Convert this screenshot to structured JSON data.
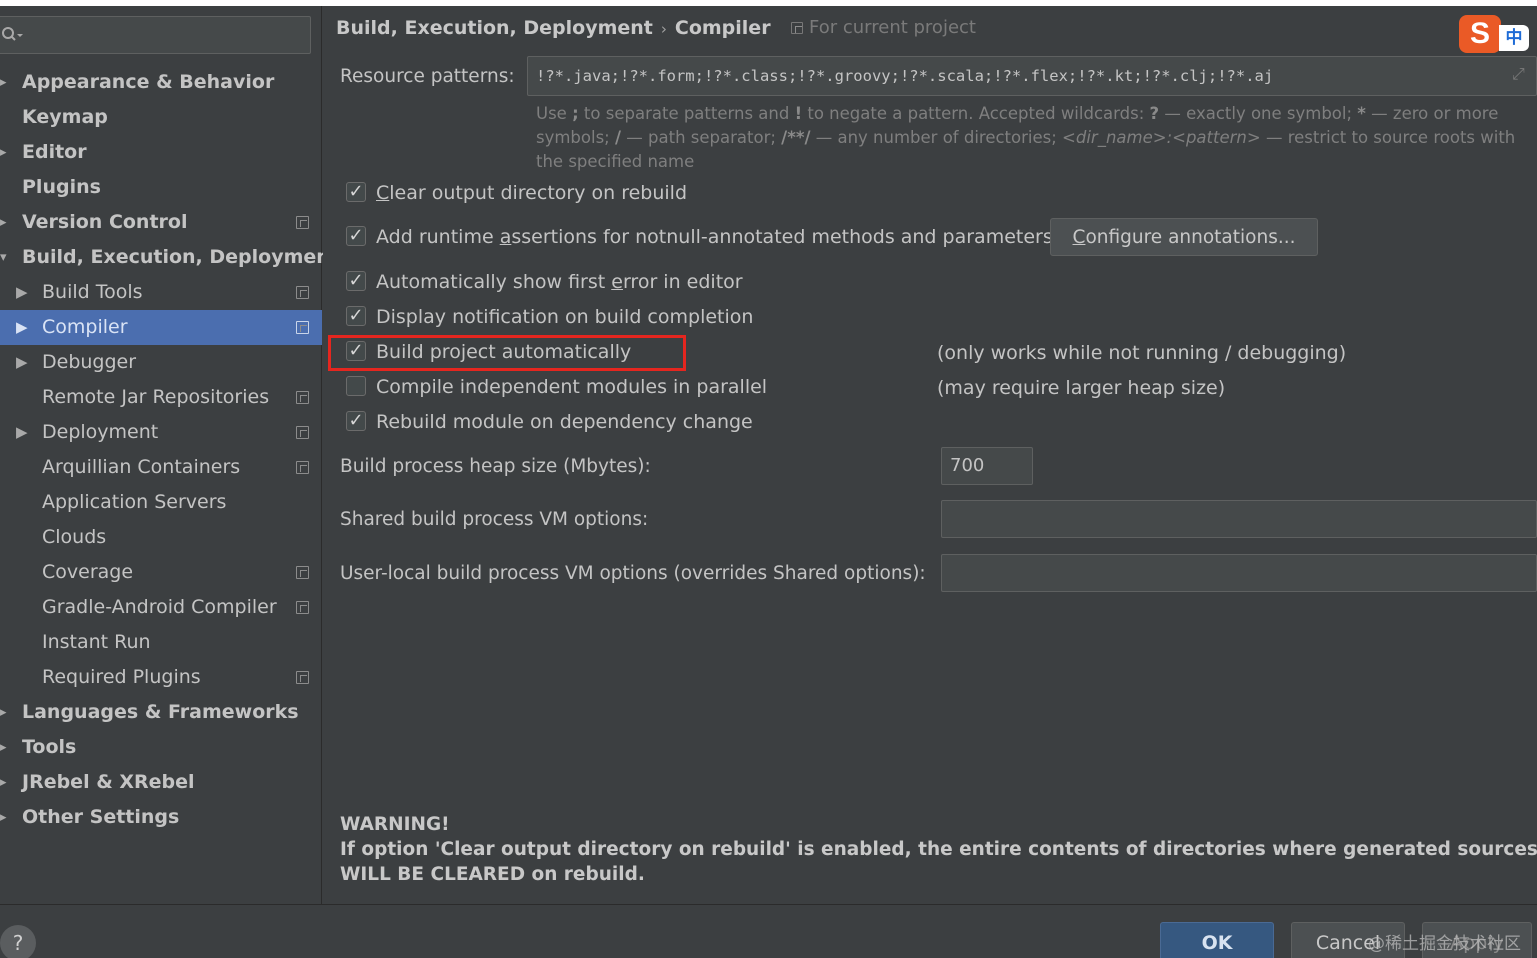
{
  "sidebar": {
    "search_placeholder": "",
    "items": [
      {
        "label": "Appearance & Behavior",
        "arrow": "▸"
      },
      {
        "label": "Keymap",
        "arrow": ""
      },
      {
        "label": "Editor",
        "arrow": "▸"
      },
      {
        "label": "Plugins",
        "arrow": ""
      },
      {
        "label": "Version Control",
        "arrow": "▸"
      },
      {
        "label": "Build, Execution, Deployment",
        "arrow": "▾"
      },
      {
        "label": "Build Tools",
        "arrow": "▶"
      },
      {
        "label": "Compiler",
        "arrow": "▶"
      },
      {
        "label": "Debugger",
        "arrow": "▶"
      },
      {
        "label": "Remote Jar Repositories",
        "arrow": ""
      },
      {
        "label": "Deployment",
        "arrow": "▶"
      },
      {
        "label": "Arquillian Containers",
        "arrow": ""
      },
      {
        "label": "Application Servers",
        "arrow": ""
      },
      {
        "label": "Clouds",
        "arrow": ""
      },
      {
        "label": "Coverage",
        "arrow": ""
      },
      {
        "label": "Gradle-Android Compiler",
        "arrow": ""
      },
      {
        "label": "Instant Run",
        "arrow": ""
      },
      {
        "label": "Required Plugins",
        "arrow": ""
      },
      {
        "label": "Languages & Frameworks",
        "arrow": "▸"
      },
      {
        "label": "Tools",
        "arrow": "▸"
      },
      {
        "label": "JRebel & XRebel",
        "arrow": "▸"
      },
      {
        "label": "Other Settings",
        "arrow": "▸"
      }
    ]
  },
  "header": {
    "crumb1": "Build, Execution, Deployment",
    "separator": "›",
    "crumb2": "Compiler",
    "for_project": "For current project",
    "ime_logo": "S",
    "ime_lang": "中"
  },
  "form": {
    "resource_label": "Resource patterns:",
    "resource_value": "!?*.java;!?*.form;!?*.class;!?*.groovy;!?*.scala;!?*.flex;!?*.kt;!?*.clj;!?*.aj",
    "hint": {
      "p1": "Use ",
      "semicolon": ";",
      "p2": " to separate patterns and ",
      "bang": "!",
      "p3": " to negate a pattern. Accepted wildcards: ",
      "q": "?",
      "p4": " — exactly one symbol; ",
      "star": "*",
      "p5": " — zero or more symbols; ",
      "slash": "/",
      "p6": " — path separator; ",
      "globstar": "/**/",
      "p7": " — any number of directories; ",
      "dirpat": "<dir_name>:<pattern>",
      "p8": " — restrict to source roots with the specified name"
    },
    "checks": [
      {
        "pre": "",
        "mn": "C",
        "post": "lear output directory on rebuild",
        "checked": true
      },
      {
        "pre": "Add runtime ",
        "mn": "a",
        "post": "ssertions for notnull-annotated methods and parameters",
        "checked": true
      },
      {
        "pre": "Automatically show first ",
        "mn": "e",
        "post": "rror in editor",
        "checked": true
      },
      {
        "pre": "Display notification on build completion",
        "mn": "",
        "post": "",
        "checked": true
      },
      {
        "pre": "Build project automatically",
        "mn": "",
        "post": "",
        "checked": true
      },
      {
        "pre": "Compile independent modules in parallel",
        "mn": "",
        "post": "",
        "checked": false
      },
      {
        "pre": "Rebuild module on dependency change",
        "mn": "",
        "post": "",
        "checked": true
      }
    ],
    "configure": {
      "mn": "C",
      "rest": "onfigure annotations..."
    },
    "note_build_auto": "(only works while not running / debugging)",
    "note_parallel": "(may require larger heap size)",
    "heap_label": "Build process heap size (Mbytes):",
    "heap_value": "700",
    "shared_label": "Shared build process VM options:",
    "shared_value": "",
    "user_label": "User-local build process VM options (overrides Shared options):",
    "user_value": ""
  },
  "warning": {
    "title": "WARNING!",
    "line1": "If option 'Clear output directory on rebuild' is enabled, the entire contents of directories where generated sources are stored",
    "line2": "WILL BE CLEARED on rebuild."
  },
  "footer": {
    "help": "?",
    "ok": "OK",
    "cancel": "Cancel",
    "apply": "Apply",
    "watermark": "@稀土掘金技术社区"
  },
  "colors": {
    "background": "#3c3f41",
    "selection": "#4b6eaf",
    "ok_button": "#365880",
    "highlight": "#e5261f"
  }
}
